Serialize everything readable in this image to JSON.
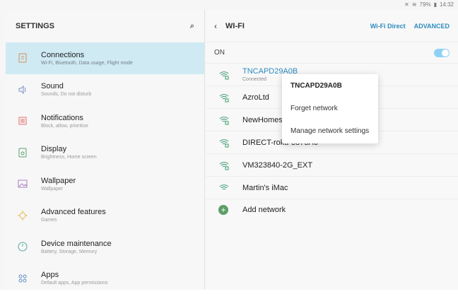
{
  "status_bar": {
    "icons": [
      "mute-icon",
      "wifi-icon"
    ],
    "battery": "79%",
    "time": "14:32"
  },
  "left_panel": {
    "title": "SETTINGS",
    "search_icon": "search-icon",
    "items": [
      {
        "label": "Connections",
        "sub": "Wi-Fi, Bluetooth, Data usage, Flight mode",
        "icon": "connections-icon",
        "selected": true
      },
      {
        "label": "Sound",
        "sub": "Sounds, Do not disturb",
        "icon": "sound-icon"
      },
      {
        "label": "Notifications",
        "sub": "Block, allow, prioritise",
        "icon": "notifications-icon"
      },
      {
        "label": "Display",
        "sub": "Brightness, Home screen",
        "icon": "display-icon"
      },
      {
        "label": "Wallpaper",
        "sub": "Wallpaper",
        "icon": "wallpaper-icon"
      },
      {
        "label": "Advanced features",
        "sub": "Games",
        "icon": "advanced-features-icon"
      },
      {
        "label": "Device maintenance",
        "sub": "Battery, Storage, Memory",
        "icon": "device-maintenance-icon"
      },
      {
        "label": "Apps",
        "sub": "Default apps, App permissions",
        "icon": "apps-icon"
      }
    ]
  },
  "right_panel": {
    "title": "WI-FI",
    "links": [
      "Wi-Fi Direct",
      "ADVANCED"
    ],
    "on_label": "ON",
    "networks": [
      {
        "name": "TNCAPD29A0B",
        "sub": "Connected",
        "active": true,
        "icon": "wifi-lock-icon"
      },
      {
        "name": "AzroLtd",
        "icon": "wifi-lock-icon"
      },
      {
        "name": "NewHomes",
        "icon": "wifi-lock-icon"
      },
      {
        "name": "DIRECT-roku-8575A6",
        "icon": "wifi-lock-icon"
      },
      {
        "name": "VM323840-2G_EXT",
        "icon": "wifi-lock-icon"
      },
      {
        "name": "Martin's iMac",
        "icon": "wifi-icon"
      }
    ],
    "add_network": "Add network"
  },
  "popup": {
    "title": "TNCAPD29A0B",
    "options": [
      "Forget network",
      "Manage network settings"
    ]
  }
}
